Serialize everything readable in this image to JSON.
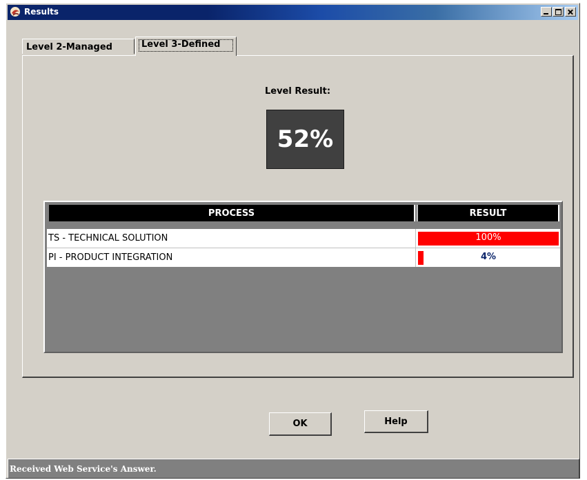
{
  "window": {
    "title": "Results",
    "icon": "java-app-icon",
    "controls": [
      "minimize",
      "maximize",
      "close"
    ]
  },
  "tabs": [
    {
      "label": "Level 2-Managed",
      "selected": false
    },
    {
      "label": "Level 3-Defined",
      "selected": true
    }
  ],
  "level": {
    "label": "Level Result:",
    "value": "52%"
  },
  "table": {
    "headers": {
      "process": "PROCESS",
      "result": "RESULT"
    },
    "rows": [
      {
        "process": "TS - TECHNICAL SOLUTION",
        "result": "100%",
        "fraction": 1.0
      },
      {
        "process": "PI - PRODUCT INTEGRATION",
        "result": "4%",
        "fraction": 0.04
      }
    ]
  },
  "buttons": {
    "ok": "OK",
    "help": "Help"
  },
  "status": {
    "text": "Received Web Service's Answer."
  },
  "colors": {
    "window_bg": "#d4d0c8",
    "titlebar": "#0a246a",
    "bar_fill": "#ff0000",
    "score_box": "#404040",
    "header_bg": "#000000",
    "status_bg": "#808080"
  }
}
